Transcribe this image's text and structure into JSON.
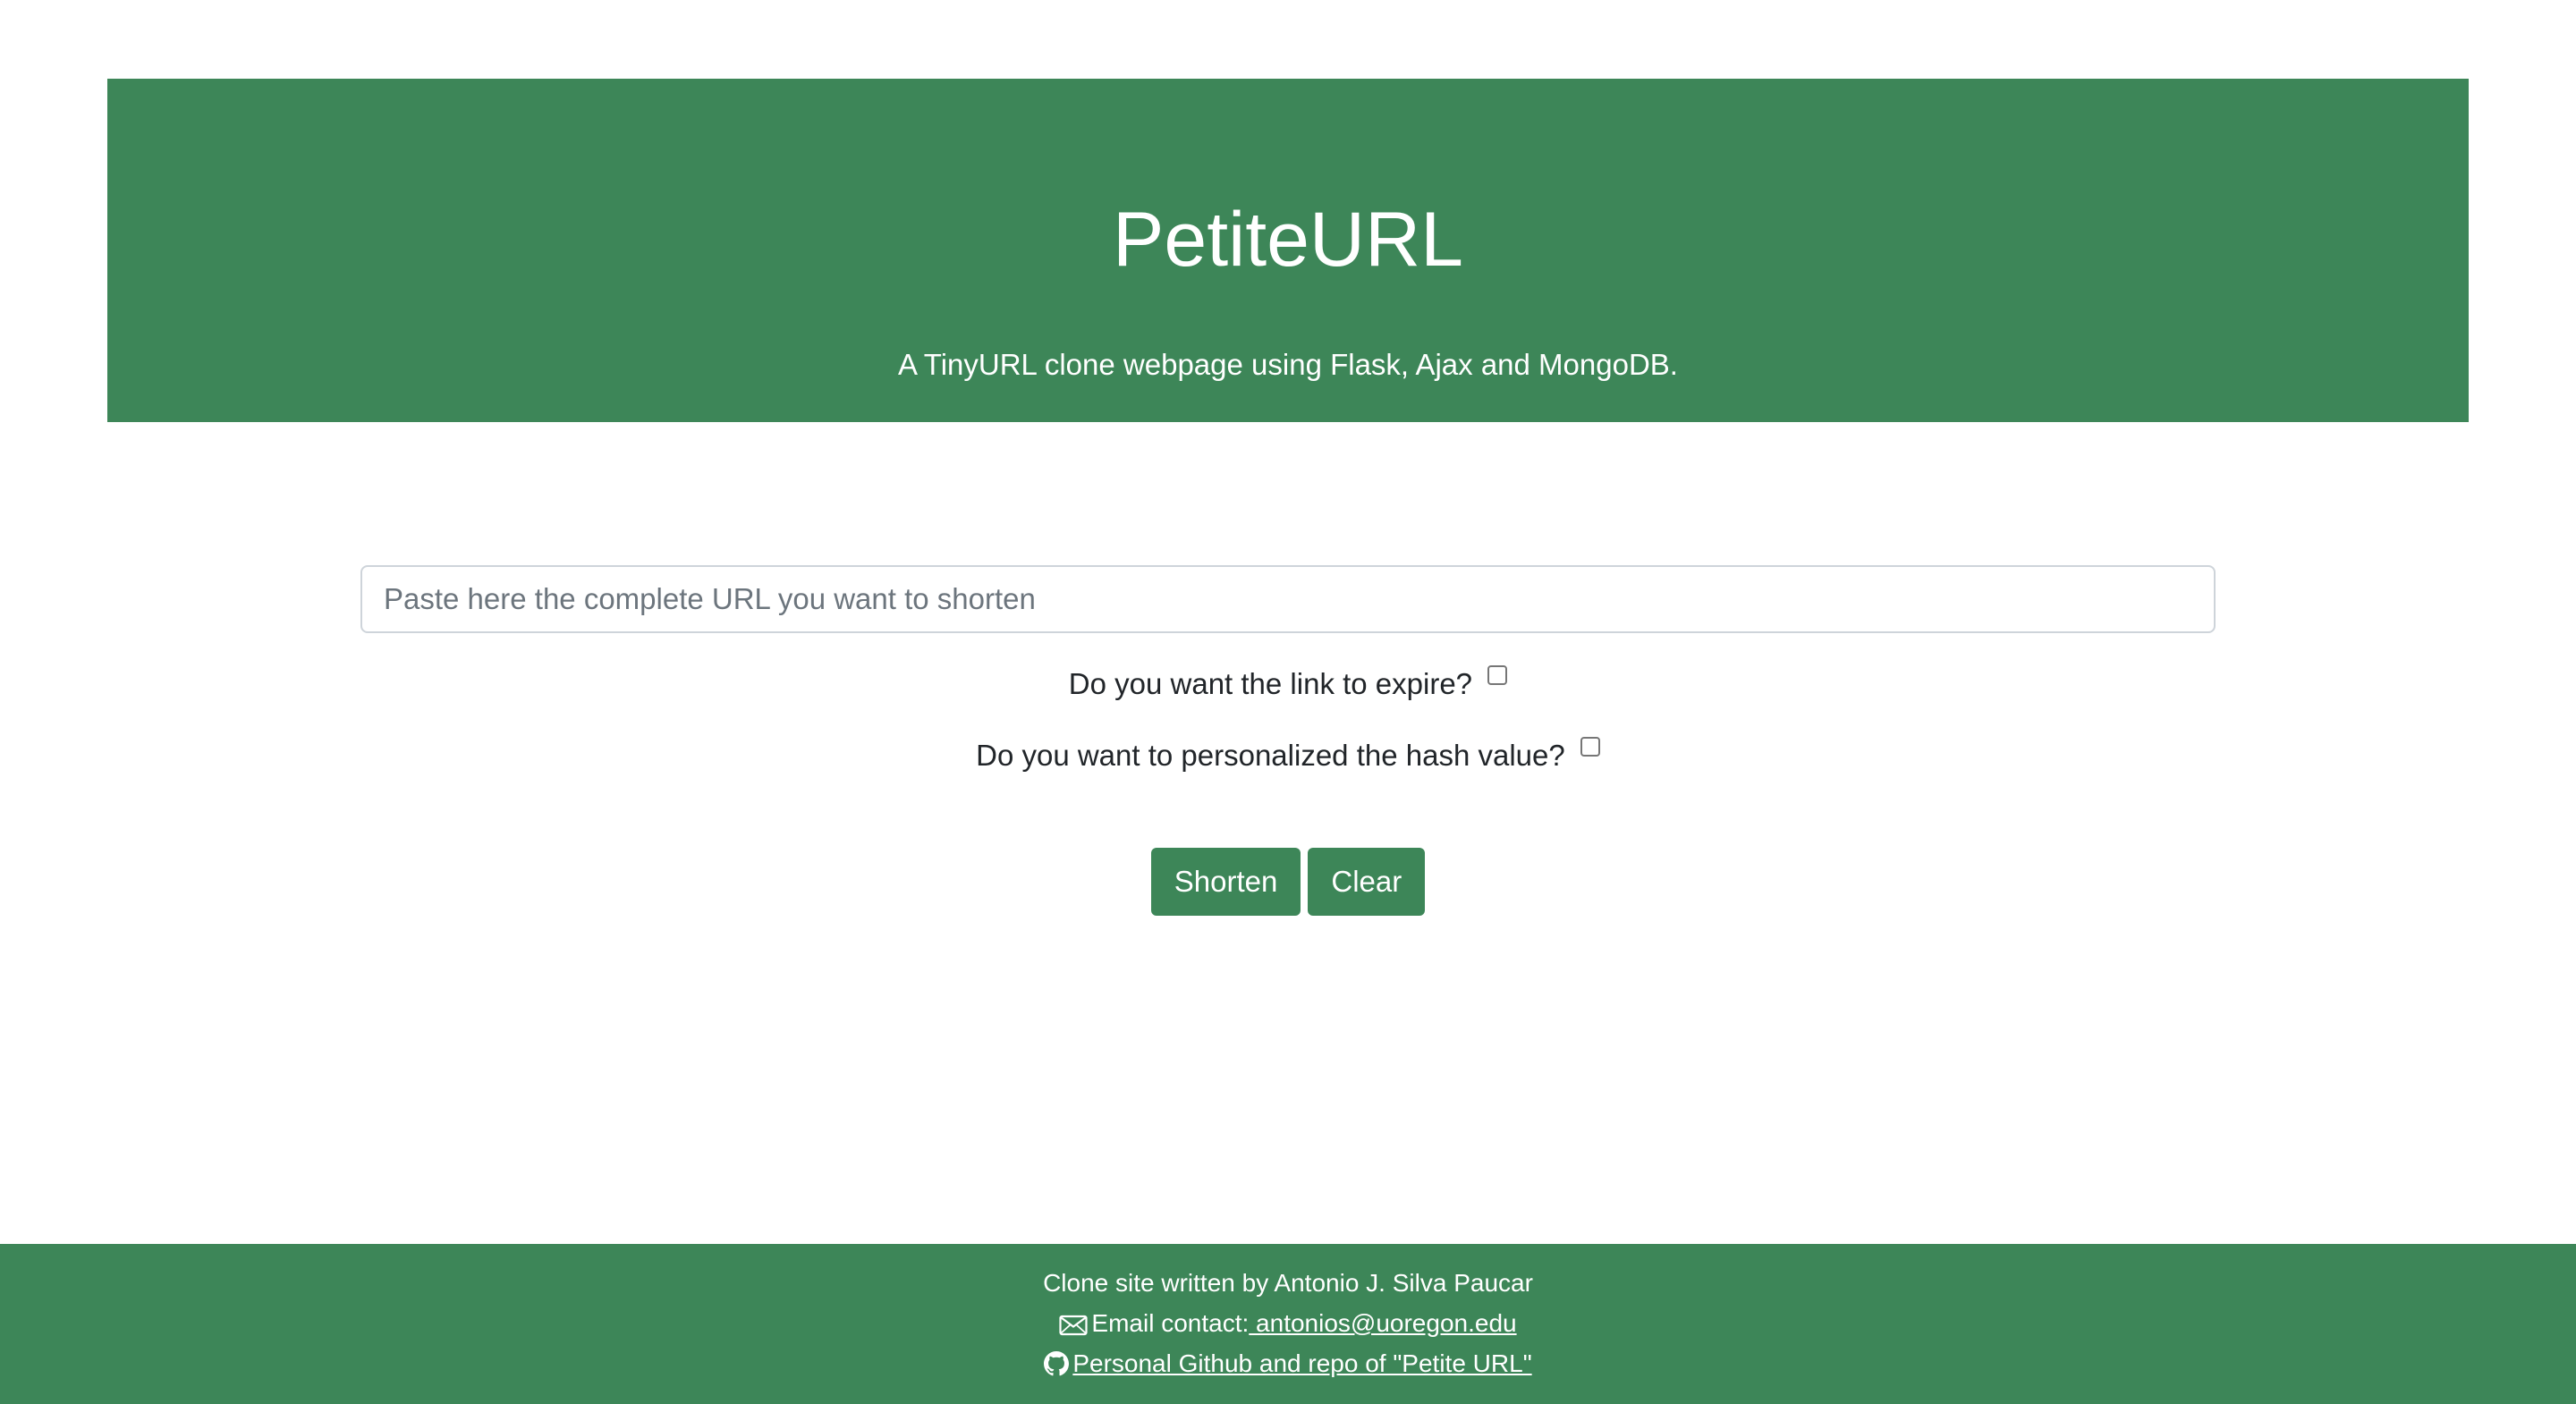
{
  "header": {
    "title": "PetiteURL",
    "subtitle": "A TinyURL clone webpage using Flask, Ajax and MongoDB."
  },
  "form": {
    "url_placeholder": "Paste here the complete URL you want to shorten",
    "url_value": "",
    "expire_label": "Do you want the link to expire?",
    "expire_checked": false,
    "hash_label": "Do you want to personalized the hash value?",
    "hash_checked": false,
    "shorten_label": "Shorten",
    "clear_label": "Clear"
  },
  "footer": {
    "credit": "Clone site written by Antonio J. Silva Paucar",
    "email_label": "Email contact:",
    "email_link": " antonios@uoregon.edu",
    "github_link": "Personal Github and repo of \"Petite URL\"",
    "icons": [
      "envelope-icon",
      "github-icon"
    ]
  },
  "colors": {
    "brand_green": "#3d8658",
    "text": "#212529",
    "input_border": "#ced4da"
  }
}
